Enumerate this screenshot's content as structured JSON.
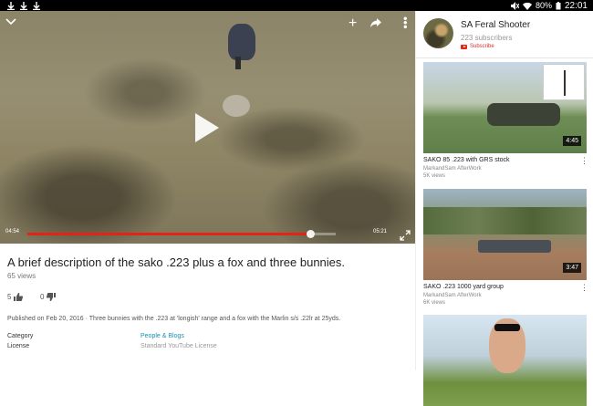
{
  "status_bar": {
    "battery": "80%",
    "time": "22:01"
  },
  "player": {
    "current_time": "04:54",
    "duration": "05:21",
    "progress": 0.92
  },
  "video": {
    "title": "A brief description of the sako .223 plus a fox and three bunnies.",
    "views": "65 views",
    "likes": "5",
    "dislikes": "0",
    "description": "Published on Feb 20, 2016 · Three bunnies with the .223 at 'longish' range and a fox with the Marlin s/s .22lr at 25yds.",
    "meta": [
      {
        "label": "Category",
        "value": "People & Blogs"
      },
      {
        "label": "License",
        "value": "Standard YouTube License"
      }
    ]
  },
  "channel": {
    "name": "SA Feral Shooter",
    "subscribers": "223 subscribers",
    "subscribe_label": "Subscribe"
  },
  "related": [
    {
      "title": "SAKO 85 .223 with GRS stock",
      "author": "MarkandSam AfterWork",
      "views": "5K views",
      "duration": "4:45"
    },
    {
      "title": "SAKO .223 1000 yard group",
      "author": "MarkandSam AfterWork",
      "views": "6K views",
      "duration": "3:47"
    },
    {
      "title": "",
      "author": "",
      "views": "",
      "duration": ""
    }
  ],
  "colors": {
    "accent": "#e62117",
    "link": "#1a8fb0"
  }
}
